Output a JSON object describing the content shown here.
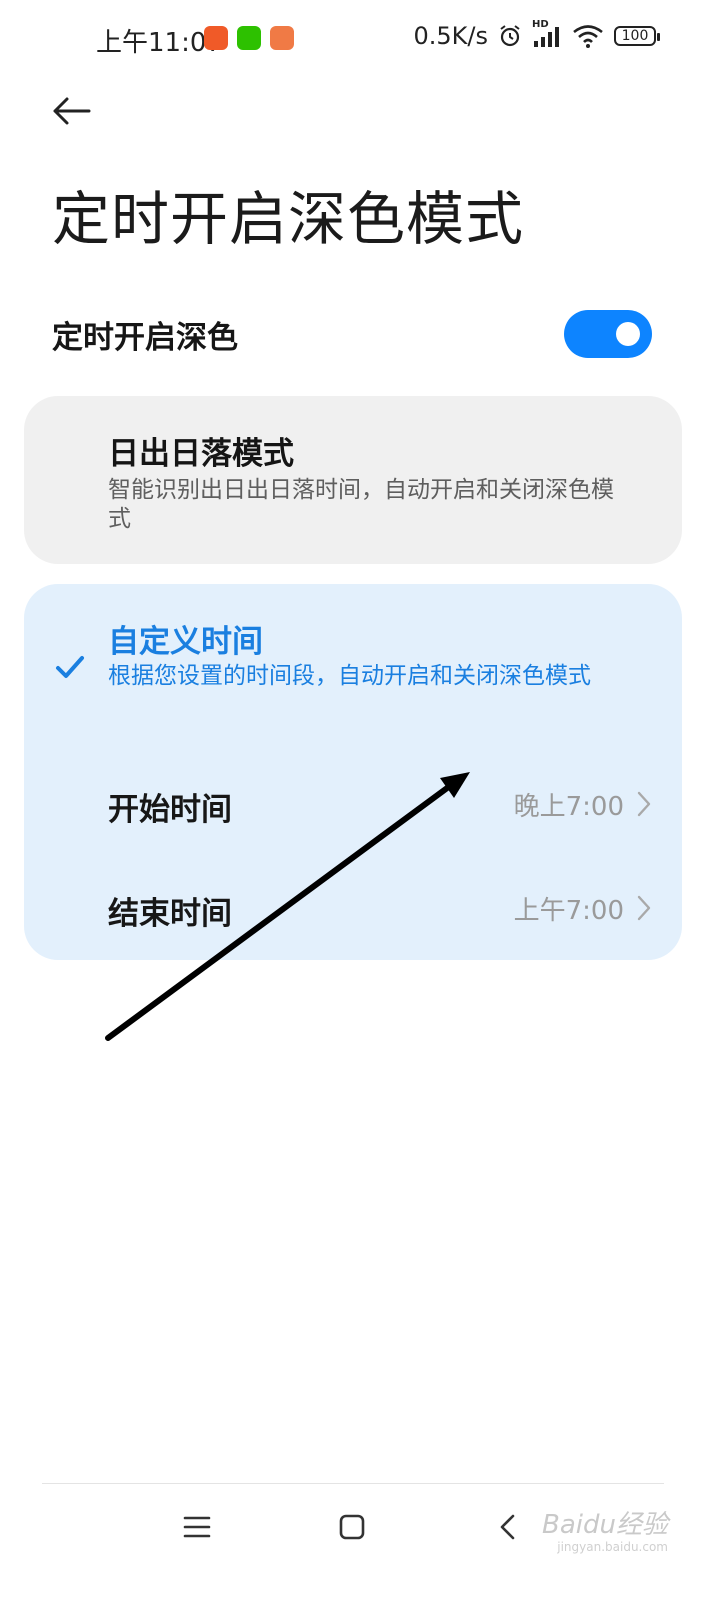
{
  "status_bar": {
    "time": "上午11:07",
    "network_speed": "0.5K/s",
    "signal_label": "HD",
    "battery": "100",
    "icons": [
      "taobao-app-icon",
      "wechat-app-icon",
      "orange-app-icon",
      "alarm-icon",
      "signal-icon",
      "wifi-icon",
      "battery-icon"
    ]
  },
  "header": {
    "title": "定时开启深色模式"
  },
  "toggle_row": {
    "label": "定时开启深色",
    "enabled": true
  },
  "options": {
    "sunrise": {
      "title": "日出日落模式",
      "description": "智能识别出日出日落时间，自动开启和关闭深色模式",
      "selected": false
    },
    "custom": {
      "title": "自定义时间",
      "description": "根据您设置的时间段，自动开启和关闭深色模式",
      "selected": true
    }
  },
  "times": {
    "start_label": "开始时间",
    "start_value": "晚上7:00",
    "end_label": "结束时间",
    "end_value": "上午7:00"
  },
  "watermark": {
    "text": "Baidu经验",
    "url": "jingyan.baidu.com"
  },
  "colors": {
    "accent": "#0d84ff",
    "selected_text": "#1a7fe0",
    "selected_card": "#e3f0fc",
    "unselected_card": "#f0f0f0"
  }
}
